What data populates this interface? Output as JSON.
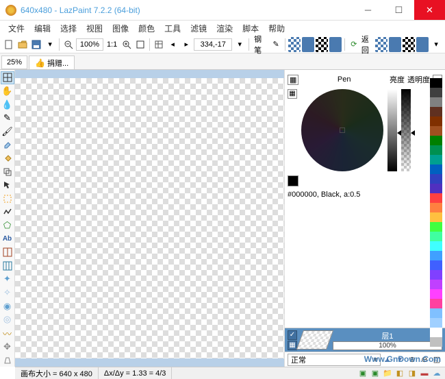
{
  "window": {
    "title": "640x480 - LazPaint 7.2.2 (64-bit)"
  },
  "menu": {
    "items": [
      "文件",
      "编辑",
      "选择",
      "视图",
      "图像",
      "颜色",
      "工具",
      "滤镜",
      "渲染",
      "脚本",
      "帮助"
    ]
  },
  "toolbar": {
    "zoom_value": "100%",
    "ratio_label": "1:1",
    "coords": "334,-17",
    "pen_label": "钢笔",
    "undo_label": "返回"
  },
  "tabrow": {
    "zoom_pct": "25%",
    "donate_label": "捐赠..."
  },
  "tools": [
    "grid-icon",
    "hand-icon",
    "color-picker-icon",
    "pen-icon",
    "brush-icon",
    "eraser-icon",
    "flood-fill-icon",
    "clone-icon",
    "arrow-icon",
    "rect-select-icon",
    "lasso-icon",
    "home-icon",
    "text-icon",
    "align-icon",
    "grid2-icon",
    "sparkle-icon",
    "sparkle2-icon",
    "light-icon",
    "light2-icon",
    "deform-icon",
    "move-icon",
    "perspective-icon"
  ],
  "color_panel": {
    "pen_label": "Pen",
    "lightness_label": "亮度",
    "opacity_label": "透明度",
    "readout": "#000000, Black, a:0.5"
  },
  "palette": [
    "#000000",
    "#404040",
    "#808080",
    "#603020",
    "#803000",
    "#a05020",
    "#008000",
    "#009050",
    "#00a090",
    "#0060c0",
    "#3040c0",
    "#5030c0",
    "#ff4040",
    "#ff8040",
    "#ffc040",
    "#40ff40",
    "#40ffa0",
    "#40ffff",
    "#40a0ff",
    "#4060ff",
    "#8040ff",
    "#c040ff",
    "#ff40ff",
    "#ff40a0",
    "#80c0ff",
    "#a0d0ff",
    "#ffffff",
    "#c0c0c0"
  ],
  "layers": {
    "layer_name": "层1",
    "opacity": "100%",
    "blend_mode": "正常"
  },
  "status": {
    "size_label": "画布大小 = 640 x 480",
    "ratio_label": "Δx/Δy = 1.33 = 4/3"
  },
  "watermark": "Www.GnDown.Com"
}
